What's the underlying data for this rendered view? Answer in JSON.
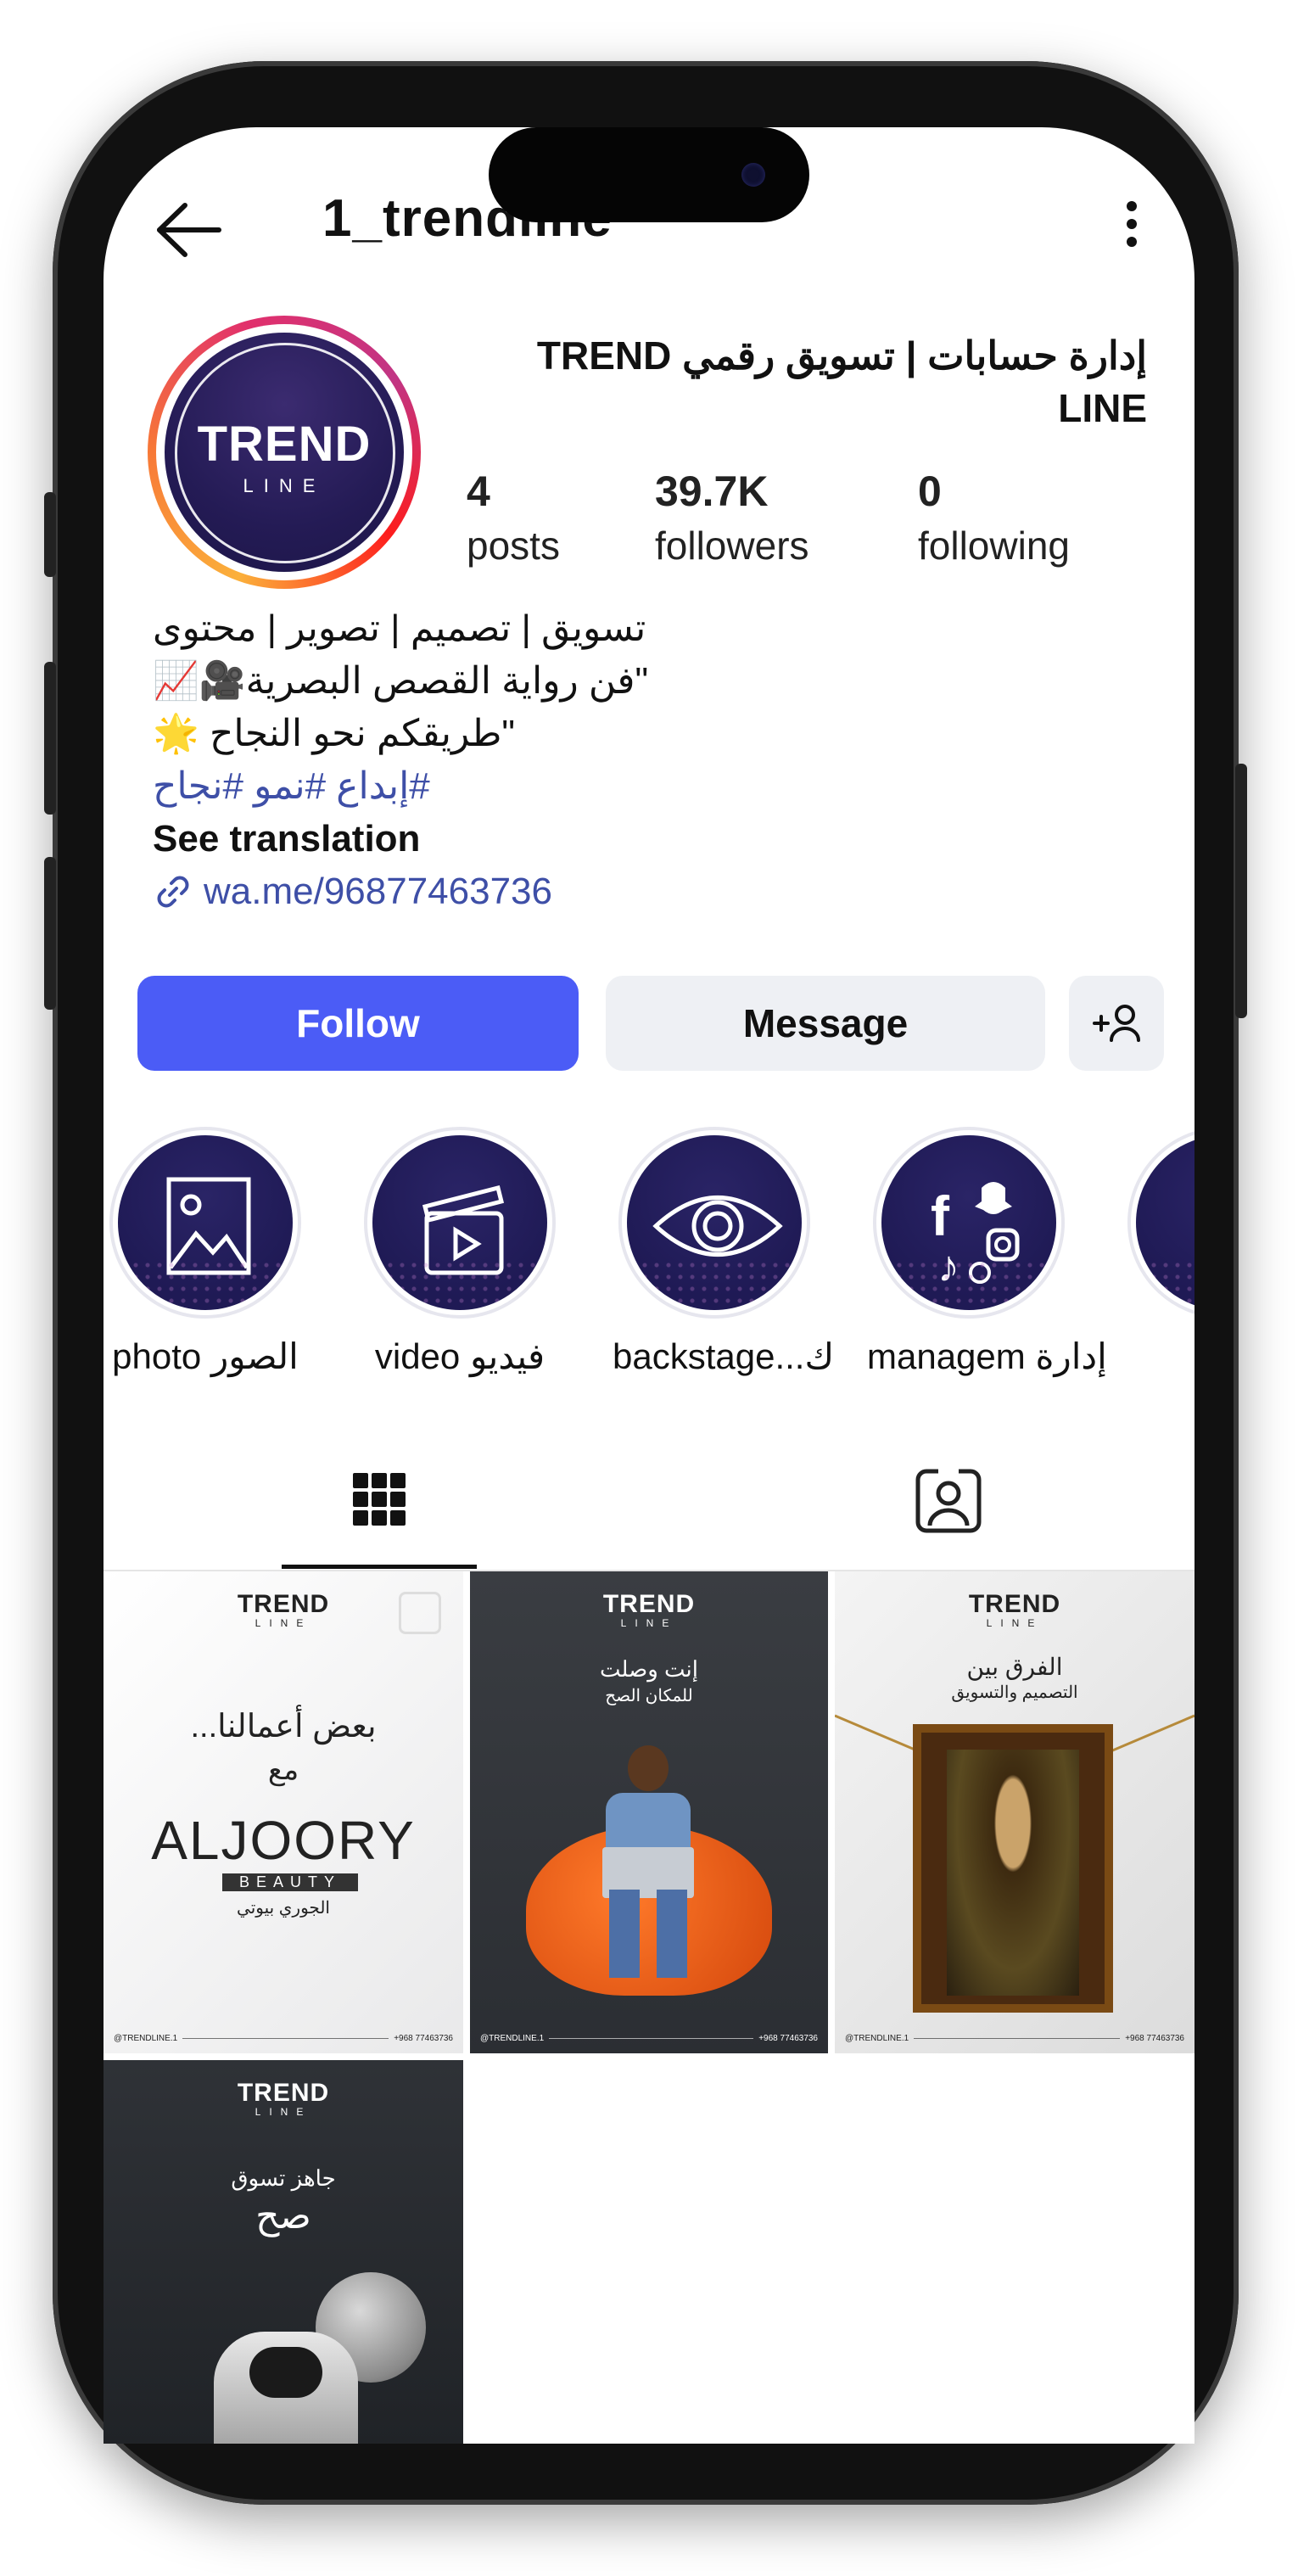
{
  "header": {
    "username": "1_trendline"
  },
  "profile": {
    "avatar_text_main": "TREND",
    "avatar_text_sub": "LINE",
    "name": "إدارة حسابات | تسويق رقمي TREND LINE",
    "stats": [
      {
        "value": "4",
        "label": "posts"
      },
      {
        "value": "39.7K",
        "label": "followers"
      },
      {
        "value": "0",
        "label": "following"
      }
    ],
    "bio": {
      "line1": "تسويق | تصميم | تصوير | محتوى",
      "line2": "\"فن رواية القصص البصرية🎥📈",
      "line3": "\"طريقكم نحو النجاح 🌟",
      "hashtags": "#إبداع #نمو #نجاح",
      "see_translation": "See translation",
      "link": "wa.me/96877463736"
    }
  },
  "actions": {
    "follow": "Follow",
    "message": "Message",
    "add_user": "+"
  },
  "highlights": [
    {
      "label": "photo الصور",
      "icon": "image-icon"
    },
    {
      "label": "video فيديو",
      "icon": "clapperboard-icon"
    },
    {
      "label": "backstage...ك",
      "icon": "eye-icon"
    },
    {
      "label": "managem إدارة",
      "icon": "social-apps-icon"
    },
    {
      "label": "",
      "icon": "highlight-icon"
    }
  ],
  "tabs": {
    "grid": "grid-icon",
    "tagged": "tagged-icon"
  },
  "posts": [
    {
      "brand": "TREND",
      "brand_sub": "LINE",
      "line1": "بعض أعمالنا...",
      "line2": "مع",
      "logo": "ALJOORY",
      "logo_sub": "BEAUTY",
      "logo_ar": "الجوري بيوتي",
      "foot_left": "@TRENDLINE.1",
      "foot_right": "+968 77463736"
    },
    {
      "brand": "TREND",
      "brand_sub": "LINE",
      "line1": "إنت وصلت",
      "line2": "للمكان الصح",
      "foot_left": "@TRENDLINE.1",
      "foot_right": "+968 77463736"
    },
    {
      "brand": "TREND",
      "brand_sub": "LINE",
      "line1": "الفرق بين",
      "line2": "التصميم والتسويق",
      "foot_left": "@TRENDLINE.1",
      "foot_right": "+968 77463736"
    },
    {
      "brand": "TREND",
      "brand_sub": "LINE",
      "line1": "جاهز تسوق",
      "line2": "صح"
    }
  ]
}
